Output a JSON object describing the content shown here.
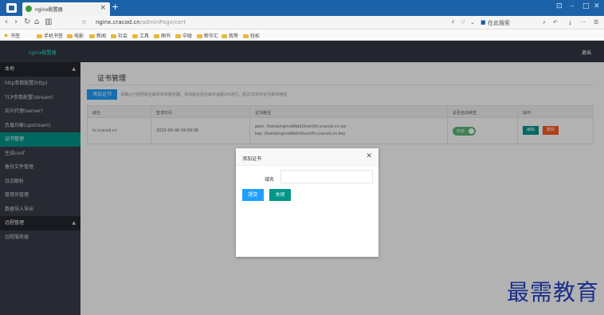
{
  "browser": {
    "tab_title": "nginx配置器",
    "new_tab": "+",
    "window_controls": [
      "⊡",
      "–",
      "□",
      "✕"
    ],
    "url_host": "nginx.cracod.cn",
    "url_path": "/adminPage/cert",
    "addr_right": [
      "⚡",
      "♡",
      "⌄",
      "在此搜索",
      "⌕",
      "↶",
      "⤓",
      "···",
      "☰"
    ],
    "bookmarks": [
      "书签",
      "手机书签",
      "电影",
      "新闻",
      "社会",
      "工具",
      "图书",
      "中级",
      "新华汇",
      "我等",
      "轻松"
    ]
  },
  "header": {
    "logo": "nginx配置器",
    "logout": "退出"
  },
  "sidebar": {
    "groups": [
      {
        "label": "本地",
        "caret": "▲",
        "items": [
          {
            "label": "http参数配置(http)"
          },
          {
            "label": "TCP参数配置(stream)"
          },
          {
            "label": "反向代理(server)"
          },
          {
            "label": "负载均衡(upstream)"
          },
          {
            "label": "证书管理",
            "active": true
          },
          {
            "label": "生成conf"
          },
          {
            "label": "备份文件管理"
          },
          {
            "label": "日志解析"
          },
          {
            "label": "管理员管理"
          },
          {
            "label": "数据导入导出"
          }
        ]
      },
      {
        "label": "远程管理",
        "caret": "▲",
        "items": [
          {
            "label": "远程服务器"
          }
        ]
      }
    ]
  },
  "main": {
    "title": "证书管理",
    "add_button": "添加证书",
    "hint": "请确认已经把域名解析到本服务器，添加域名后在每天凌晨2点进行，超过30天的证书即将续签",
    "table": {
      "headers": [
        "域名",
        "签发时间",
        "证书路径",
        "是否自动续签",
        "操作"
      ],
      "rows": [
        {
          "domain": "hr.cracod.cn",
          "issued": "2020-06-06 09:58:06",
          "pem": "pem: /home/nginxWebUI/cert/hr.cracod.cn.cer",
          "key": "key: /home/nginxWebUI/cert/hr.cracod.cn.key",
          "auto_renew": "开启",
          "edit": "编辑",
          "delete": "删除"
        }
      ]
    }
  },
  "dialog": {
    "title": "添加证书",
    "close": "✕",
    "field_label": "域名",
    "field_value": "",
    "field_placeholder": "",
    "submit": "提交",
    "close_button": "关闭"
  },
  "watermark": "最需教育",
  "colors": {
    "tabbar": "#1c62a8",
    "header": "#23262e",
    "sidebar": "#393d49",
    "active": "#009688",
    "primary": "#1e9fff",
    "danger": "#ff5722",
    "toggle_on": "#5fb878"
  }
}
